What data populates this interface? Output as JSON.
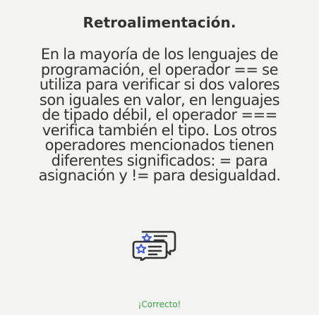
{
  "feedback": {
    "title": "Retroalimentación.",
    "body_lines": [
      "En la mayoría de los lenguajes de",
      "programación, el operador == se",
      "utiliza para verificar si dos valores",
      "son iguales en valor, en lenguajes",
      "de tipado débil, el operador ===",
      "verifica también el tipo. Los otros",
      "operadores mencionados tienen",
      "diferentes significados: = para",
      "asignación y != para desigualdad."
    ],
    "icon": "feedback-chat-star-icon",
    "status": "¡Correcto!",
    "status_color": "#3aa143",
    "icon_accent_color": "#3b5bdb"
  }
}
